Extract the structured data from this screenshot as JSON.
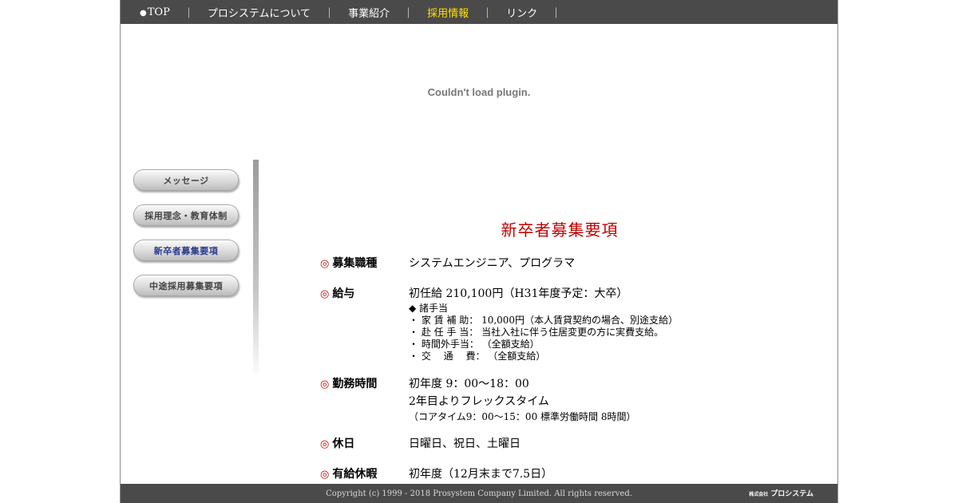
{
  "nav": {
    "items": [
      {
        "label": "TOP",
        "active": false
      },
      {
        "label": "プロシステムについて",
        "active": false
      },
      {
        "label": "事業紹介",
        "active": false
      },
      {
        "label": "採用情報",
        "active": true
      },
      {
        "label": "リンク",
        "active": false
      }
    ],
    "bullet": "●",
    "separator": "｜"
  },
  "plugin": {
    "message": "Couldn't load plugin."
  },
  "sidebar": {
    "items": [
      {
        "label": "メッセージ",
        "current": false
      },
      {
        "label": "採用理念・教育体制",
        "current": false
      },
      {
        "label": "新卒者募集要項",
        "current": true
      },
      {
        "label": "中途採用募集要項",
        "current": false
      }
    ]
  },
  "main": {
    "title": "新卒者募集要項",
    "mark": "◎",
    "rows": [
      {
        "label": "募集職種",
        "lines": [
          "システムエンジニア、プログラマ"
        ]
      },
      {
        "label": "給与",
        "lines": [
          "初任給 210,100円（H31年度予定：大卒）"
        ],
        "details": [
          "◆ 諸手当",
          "・ 家 賃 補 助： 10,000円（本人賃貸契約の場合、別途支給）",
          "・ 赴 任 手 当： 当社入社に伴う住居変更の方に実費支給。",
          "・ 時間外手当： （全額支給）",
          "・ 交　 通　 費： （全額支給）"
        ]
      },
      {
        "label": "勤務時間",
        "lines": [
          "初年度 9：00～18：00",
          "2年目よりフレックスタイム"
        ],
        "note": "（コアタイム9：00～15：00 標準労働時間 8時間）"
      },
      {
        "label": "休日",
        "lines": [
          "日曜日、祝日、土曜日"
        ]
      },
      {
        "label": "有給休暇",
        "lines": [
          "初年度（12月末まで7.5日）"
        ]
      }
    ]
  },
  "footer": {
    "copyright": "Copyright (c) 1999 - 2018 Prosystem Company Limited. All rights reserved.",
    "logo_prefix": "株式会社",
    "logo_name": "プロシステム"
  },
  "colors": {
    "nav_bg": "#4a4a4a",
    "nav_active": "#ffe000",
    "title_red": "#c00000",
    "mark_red": "#cc0000"
  }
}
